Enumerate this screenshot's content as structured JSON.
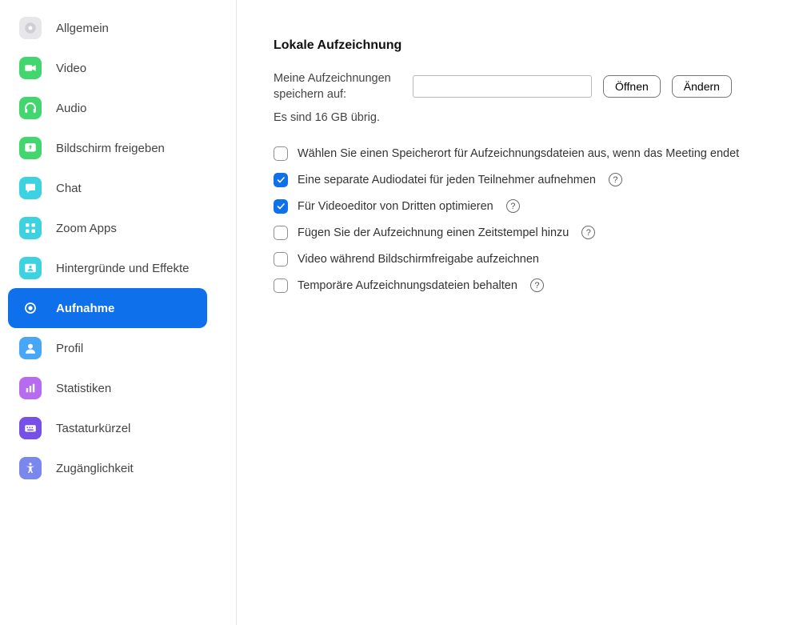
{
  "sidebar": {
    "items": [
      {
        "label": "Allgemein",
        "icon": "gear-icon",
        "bg": "#e7e7e9",
        "active": false
      },
      {
        "label": "Video",
        "icon": "video-icon",
        "bg": "#42d66f",
        "active": false
      },
      {
        "label": "Audio",
        "icon": "headphones-icon",
        "bg": "#42d66f",
        "active": false
      },
      {
        "label": "Bildschirm freigeben",
        "icon": "share-screen-icon",
        "bg": "#42d66f",
        "active": false
      },
      {
        "label": "Chat",
        "icon": "chat-icon",
        "bg": "#3cd2e0",
        "active": false
      },
      {
        "label": "Zoom Apps",
        "icon": "apps-icon",
        "bg": "#3cd2e0",
        "active": false
      },
      {
        "label": "Hintergründe und Effekte",
        "icon": "background-icon",
        "bg": "#3cd2e0",
        "active": false
      },
      {
        "label": "Aufnahme",
        "icon": "record-icon",
        "bg": "#ffffff",
        "active": true
      },
      {
        "label": "Profil",
        "icon": "profile-icon",
        "bg": "#47a7f6",
        "active": false
      },
      {
        "label": "Statistiken",
        "icon": "stats-icon",
        "bg": "#b66bf1",
        "active": false
      },
      {
        "label": "Tastaturkürzel",
        "icon": "keyboard-icon",
        "bg": "#7750e8",
        "active": false
      },
      {
        "label": "Zugänglichkeit",
        "icon": "accessibility-icon",
        "bg": "#7a88ee",
        "active": false
      }
    ]
  },
  "content": {
    "section_title": "Lokale Aufzeichnung",
    "path_label": "Meine Aufzeichnungen speichern auf:",
    "path_value": "",
    "open_button": "Öffnen",
    "change_button": "Ändern",
    "storage_info": "Es sind 16 GB übrig.",
    "options": [
      {
        "label": "Wählen Sie einen Speicherort für Aufzeichnungsdateien aus, wenn das Meeting endet",
        "checked": false,
        "help": false
      },
      {
        "label": "Eine separate Audiodatei für jeden Teilnehmer aufnehmen",
        "checked": true,
        "help": true
      },
      {
        "label": "Für Videoeditor von Dritten optimieren",
        "checked": true,
        "help": true
      },
      {
        "label": "Fügen Sie der Aufzeichnung einen Zeitstempel hinzu",
        "checked": false,
        "help": true
      },
      {
        "label": "Video während Bildschirmfreigabe aufzeichnen",
        "checked": false,
        "help": false
      },
      {
        "label": "Temporäre Aufzeichnungsdateien behalten",
        "checked": false,
        "help": true
      }
    ]
  }
}
